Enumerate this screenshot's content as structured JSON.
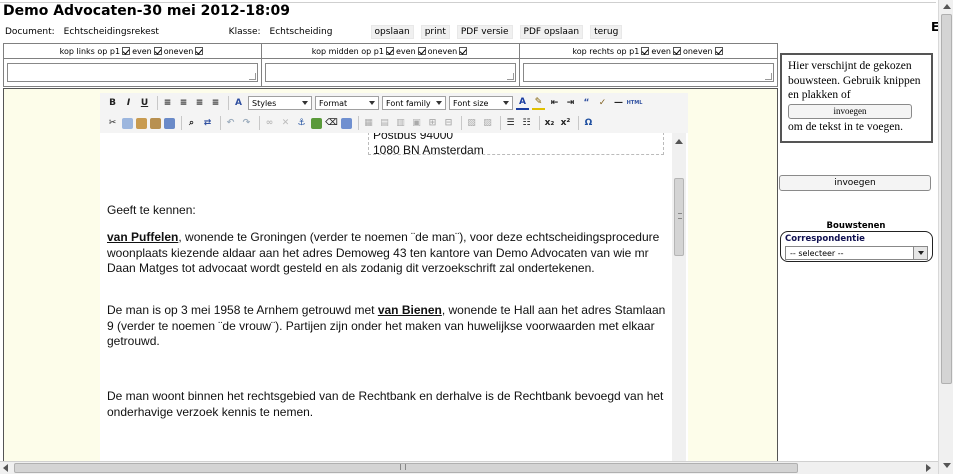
{
  "header": {
    "title": "Demo Advocaten-30 mei 2012-18:09",
    "right_letter": "E"
  },
  "docbar": {
    "document_label": "Document:",
    "document_value": "Echtscheidingsrekest",
    "klasse_label": "Klasse:",
    "klasse_value": "Echtscheiding",
    "buttons": [
      "opslaan",
      "print",
      "PDF versie",
      "PDF opslaan",
      "terug"
    ]
  },
  "headers": [
    {
      "label": "kop links op p1",
      "even": "even",
      "oneven": "oneven"
    },
    {
      "label": "kop midden op p1",
      "even": "even",
      "oneven": "oneven"
    },
    {
      "label": "kop rechts op p1",
      "even": "even",
      "oneven": "oneven"
    }
  ],
  "toolbar": {
    "styles": "Styles",
    "format": "Format",
    "font_family": "Font family",
    "font_size": "Font size"
  },
  "content": {
    "address_partial": "Postbus 94000",
    "address_city": "1080 BN Amsterdam",
    "greeting": "Geeft  te kennen:",
    "p1_name": "van Puffelen",
    "p1_text": ", wonende te Groningen (verder te noemen ¨de man¨), voor deze echtscheidingsprocedure woonplaats kiezende aldaar aan het adres Demoweg 43 ten kantore van Demo Advocaten van wie mr Daan Matges tot advocaat wordt gesteld en als zodanig dit verzoekschrift zal ondertekenen.",
    "p2_text_a": "De man is op 3 mei 1958 te Arnhem getrouwd met ",
    "p2_name": "van Bienen",
    "p2_text_b": ", wonende te Hall aan het adres Stamlaan 9 (verder te noemen ¨de vrouw¨). Partijen zijn onder het maken van huwelijkse voorwaarden met elkaar getrouwd.",
    "p3_text": "De man woont binnen het rechtsgebied van de Rechtbank en derhalve is de Rechtbank bevoegd van het onderhavige verzoek kennis te nemen."
  },
  "sidebar": {
    "preview_text_a": "Hier verschijnt de gekozen bouwsteen. Gebruik knippen en plakken of",
    "preview_button": "invoegen",
    "preview_text_b": "om de tekst in te voegen.",
    "invoegen_button": "invoegen",
    "bouwstenen_title": "Bouwstenen",
    "correspondentie_label": "Correspondentie",
    "select_value": "-- selecteer --"
  }
}
